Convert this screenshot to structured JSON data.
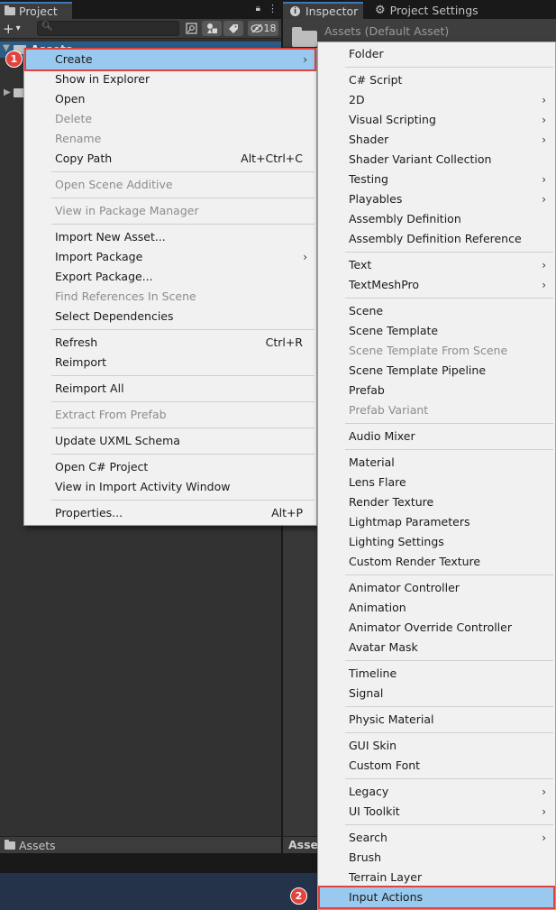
{
  "project": {
    "tab_label": "Project",
    "lock_icon": "🔒",
    "more_icon": "⋮",
    "add_icon": "+",
    "dropdown_icon": "▾",
    "search": {
      "value": "",
      "placeholder": ""
    },
    "hidden_count": "18",
    "tree_root": "Assets",
    "footer_path": "Assets"
  },
  "inspector": {
    "tab_label": "Inspector",
    "settings_tab_label": "Project Settings",
    "title": "Assets (Default Asset)",
    "footer_text": "Asse"
  },
  "context_menu": {
    "items": [
      {
        "label": "Create",
        "submenu": true
      },
      {
        "label": "Show in Explorer"
      },
      {
        "label": "Open"
      },
      {
        "label": "Delete",
        "disabled": true
      },
      {
        "label": "Rename",
        "disabled": true
      },
      {
        "label": "Copy Path",
        "shortcut": "Alt+Ctrl+C"
      },
      {
        "label": "Open Scene Additive",
        "disabled": true
      },
      {
        "label": "View in Package Manager",
        "disabled": true
      },
      {
        "label": "Import New Asset..."
      },
      {
        "label": "Import Package",
        "submenu": true
      },
      {
        "label": "Export Package..."
      },
      {
        "label": "Find References In Scene",
        "disabled": true
      },
      {
        "label": "Select Dependencies"
      },
      {
        "label": "Refresh",
        "shortcut": "Ctrl+R"
      },
      {
        "label": "Reimport"
      },
      {
        "label": "Reimport All"
      },
      {
        "label": "Extract From Prefab",
        "disabled": true
      },
      {
        "label": "Update UXML Schema"
      },
      {
        "label": "Open C# Project"
      },
      {
        "label": "View in Import Activity Window"
      },
      {
        "label": "Properties...",
        "shortcut": "Alt+P"
      }
    ]
  },
  "create_submenu": {
    "items": [
      {
        "label": "Folder"
      },
      {
        "label": "C# Script"
      },
      {
        "label": "2D",
        "submenu": true
      },
      {
        "label": "Visual Scripting",
        "submenu": true
      },
      {
        "label": "Shader",
        "submenu": true
      },
      {
        "label": "Shader Variant Collection"
      },
      {
        "label": "Testing",
        "submenu": true
      },
      {
        "label": "Playables",
        "submenu": true
      },
      {
        "label": "Assembly Definition"
      },
      {
        "label": "Assembly Definition Reference"
      },
      {
        "label": "Text",
        "submenu": true
      },
      {
        "label": "TextMeshPro",
        "submenu": true
      },
      {
        "label": "Scene"
      },
      {
        "label": "Scene Template"
      },
      {
        "label": "Scene Template From Scene",
        "disabled": true
      },
      {
        "label": "Scene Template Pipeline"
      },
      {
        "label": "Prefab"
      },
      {
        "label": "Prefab Variant",
        "disabled": true
      },
      {
        "label": "Audio Mixer"
      },
      {
        "label": "Material"
      },
      {
        "label": "Lens Flare"
      },
      {
        "label": "Render Texture"
      },
      {
        "label": "Lightmap Parameters"
      },
      {
        "label": "Lighting Settings"
      },
      {
        "label": "Custom Render Texture"
      },
      {
        "label": "Animator Controller"
      },
      {
        "label": "Animation"
      },
      {
        "label": "Animator Override Controller"
      },
      {
        "label": "Avatar Mask"
      },
      {
        "label": "Timeline"
      },
      {
        "label": "Signal"
      },
      {
        "label": "Physic Material"
      },
      {
        "label": "GUI Skin"
      },
      {
        "label": "Custom Font"
      },
      {
        "label": "Legacy",
        "submenu": true
      },
      {
        "label": "UI Toolkit",
        "submenu": true
      },
      {
        "label": "Search",
        "submenu": true
      },
      {
        "label": "Brush"
      },
      {
        "label": "Terrain Layer"
      },
      {
        "label": "Input Actions"
      }
    ]
  },
  "annotations": {
    "badge_1": "1",
    "badge_2": "2"
  },
  "colors": {
    "highlight": "#99c9ef",
    "annotation_red": "#e2433d",
    "selection_blue": "#2c5d87"
  }
}
